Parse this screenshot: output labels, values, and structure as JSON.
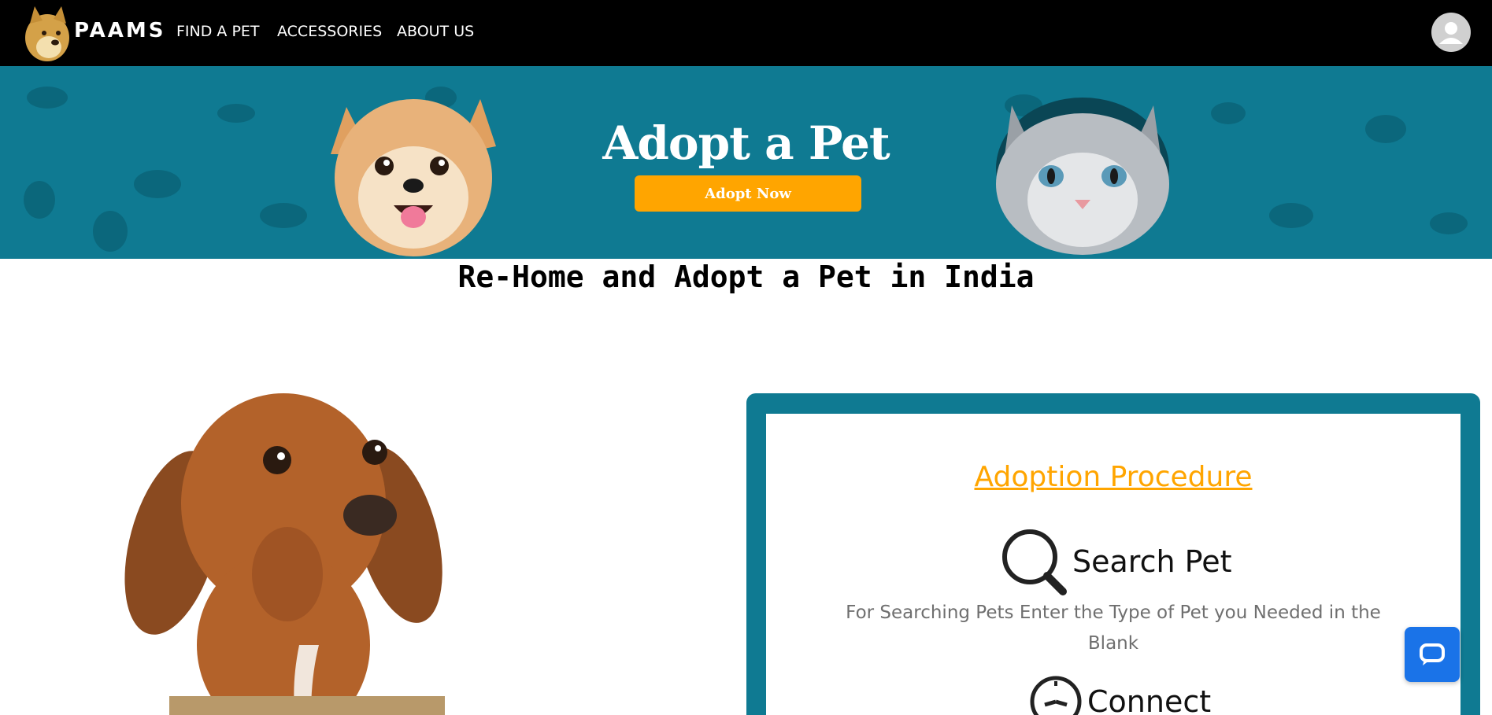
{
  "navbar": {
    "brand": "PAAMS",
    "links": [
      "FIND A PET",
      "ACCESSORIES",
      "ABOUT US"
    ]
  },
  "hero": {
    "title": "Adopt a Pet",
    "button_label": "Adopt Now"
  },
  "main": {
    "heading": "Re-Home and Adopt a Pet in India"
  },
  "procedure": {
    "title": "Adoption Procedure",
    "steps": [
      {
        "title": "Search Pet",
        "icon": "search-icon",
        "description": "For Searching Pets Enter the Type of Pet you Needed in the Blank"
      },
      {
        "title": "Connect",
        "icon": "clock-icon"
      }
    ]
  },
  "colors": {
    "navbar_bg": "#000000",
    "hero_bg": "#0f7a92",
    "accent": "#ffa500",
    "chat_button": "#1a73e8"
  }
}
